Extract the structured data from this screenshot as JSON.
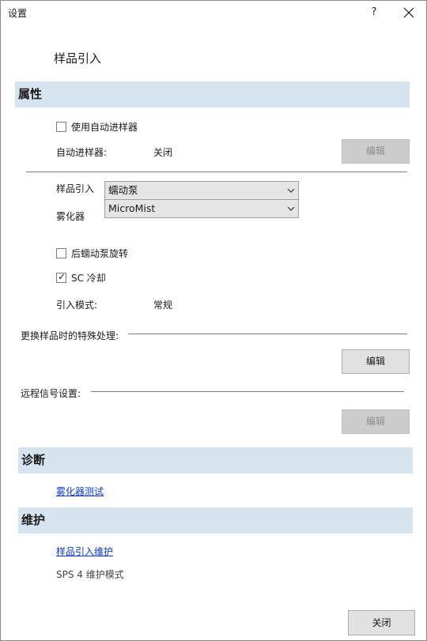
{
  "window": {
    "title": "设置",
    "help_glyph": "?"
  },
  "page_title": "样品引入",
  "properties": {
    "header": "属性",
    "use_autosampler_label": "使用自动进样器",
    "use_autosampler_checked": false,
    "autosampler_label": "自动进样器:",
    "autosampler_value": "关闭",
    "edit_label": "编辑",
    "sample_intro_label": "样品引入",
    "sample_intro_selected": "蠕动泵",
    "nebulizer_label": "雾化器",
    "nebulizer_selected": "MicroMist",
    "rear_pump_label": "后蠕动泵旋转",
    "rear_pump_checked": false,
    "sc_cooling_label": "SC 冷却",
    "sc_cooling_checked": true,
    "check_glyph": "✓",
    "intro_mode_label": "引入模式:",
    "intro_mode_value": "常规",
    "special_handling_label": "更换样品时的特殊处理:",
    "special_edit_label": "编辑",
    "remote_signal_label": "远程信号设置:",
    "remote_edit_label": "编辑"
  },
  "diagnostics": {
    "header": "诊断",
    "nebulizer_test_link": "雾化器测试"
  },
  "maintenance": {
    "header": "维护",
    "sample_intro_maint_link": "样品引入维护",
    "sps4_mode_text": "SPS 4 维护模式"
  },
  "footer": {
    "close_label": "关闭"
  },
  "icons": {
    "close": "close-icon",
    "chevron": "chevron-down-icon",
    "check": "checkmark-icon"
  }
}
